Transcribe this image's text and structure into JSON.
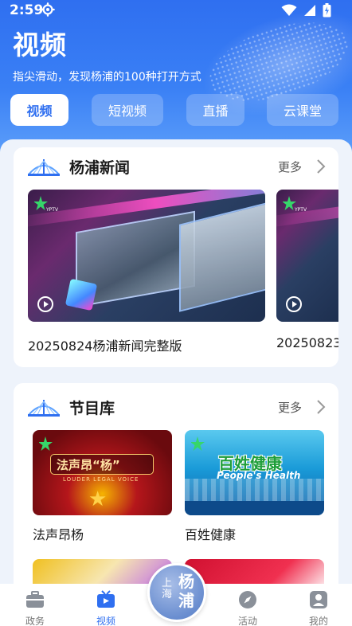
{
  "status": {
    "time": "2:59"
  },
  "header": {
    "title": "视频",
    "subtitle": "指尖滑动，发现杨浦的100种打开方式",
    "tabs": [
      {
        "label": "视频",
        "active": true
      },
      {
        "label": "短视频",
        "active": false
      },
      {
        "label": "直播",
        "active": false
      },
      {
        "label": "云课堂",
        "active": false
      }
    ]
  },
  "news_section": {
    "title": "杨浦新闻",
    "more": "更多",
    "items": [
      {
        "caption": "20250824杨浦新闻完整版"
      },
      {
        "caption": "20250823"
      }
    ]
  },
  "program_section": {
    "title": "节目库",
    "more": "更多",
    "items": [
      {
        "caption": "法声昂杨",
        "thumb_title": "法声昂“杨”",
        "thumb_subtitle": "LOUDER LEGAL VOICE"
      },
      {
        "caption": "百姓健康",
        "thumb_title": "百姓健康",
        "thumb_subtitle": "People's Health"
      }
    ]
  },
  "bottom_nav": {
    "items": [
      {
        "label": "政务",
        "icon": "briefcase-icon",
        "active": false
      },
      {
        "label": "视频",
        "icon": "tv-icon",
        "active": true
      },
      {
        "label": "活动",
        "icon": "compass-icon",
        "active": false
      },
      {
        "label": "我的",
        "icon": "profile-icon",
        "active": false
      }
    ],
    "center_badge": {
      "small": "上海",
      "big": "杨浦"
    }
  },
  "colors": {
    "accent": "#2f6ff0",
    "header_bg": "#3a80f5",
    "page_bg": "#eef3fb"
  }
}
